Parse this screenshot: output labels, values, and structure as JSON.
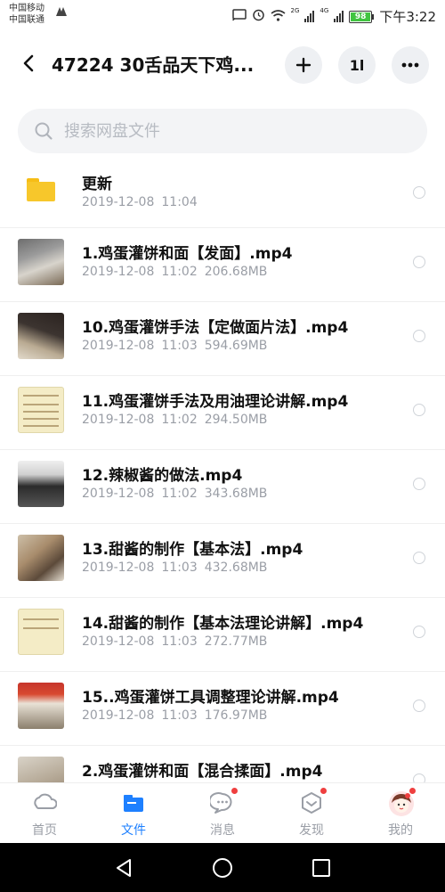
{
  "statusbar": {
    "carrier1": "中国移动",
    "carrier2": "中国联通",
    "net1": "2G",
    "net2": "4G",
    "battery": "98",
    "time": "下午3:22"
  },
  "header": {
    "title": "47224 30舌品天下鸡...",
    "add_icon": "plus-icon",
    "sort_label": "1l",
    "more_icon": "more-dots-icon"
  },
  "search": {
    "placeholder": "搜索网盘文件"
  },
  "files": [
    {
      "name": "更新",
      "date": "2019-12-08",
      "time": "11:04",
      "size": "",
      "type": "folder"
    },
    {
      "name": "1.鸡蛋灌饼和面【发面】.mp4",
      "date": "2019-12-08",
      "time": "11:02",
      "size": "206.68MB",
      "type": "video"
    },
    {
      "name": "10.鸡蛋灌饼手法【定做面片法】.mp4",
      "date": "2019-12-08",
      "time": "11:03",
      "size": "594.69MB",
      "type": "video"
    },
    {
      "name": "11.鸡蛋灌饼手法及用油理论讲解.mp4",
      "date": "2019-12-08",
      "time": "11:02",
      "size": "294.50MB",
      "type": "video"
    },
    {
      "name": "12.辣椒酱的做法.mp4",
      "date": "2019-12-08",
      "time": "11:02",
      "size": "343.68MB",
      "type": "video"
    },
    {
      "name": "13.甜酱的制作【基本法】.mp4",
      "date": "2019-12-08",
      "time": "11:03",
      "size": "432.68MB",
      "type": "video"
    },
    {
      "name": "14.甜酱的制作【基本法理论讲解】.mp4",
      "date": "2019-12-08",
      "time": "11:03",
      "size": "272.77MB",
      "type": "video"
    },
    {
      "name": "15..鸡蛋灌饼工具调整理论讲解.mp4",
      "date": "2019-12-08",
      "time": "11:03",
      "size": "176.97MB",
      "type": "video"
    },
    {
      "name": "2.鸡蛋灌饼和面【混合揉面】.mp4",
      "date": "",
      "time": "",
      "size": "",
      "type": "video"
    }
  ],
  "nav": {
    "home": "首页",
    "files": "文件",
    "messages": "消息",
    "discover": "发现",
    "me": "我的"
  },
  "colors": {
    "accent": "#1e80ff",
    "folder": "#f7c72b",
    "badge": "#ef3f3f"
  }
}
